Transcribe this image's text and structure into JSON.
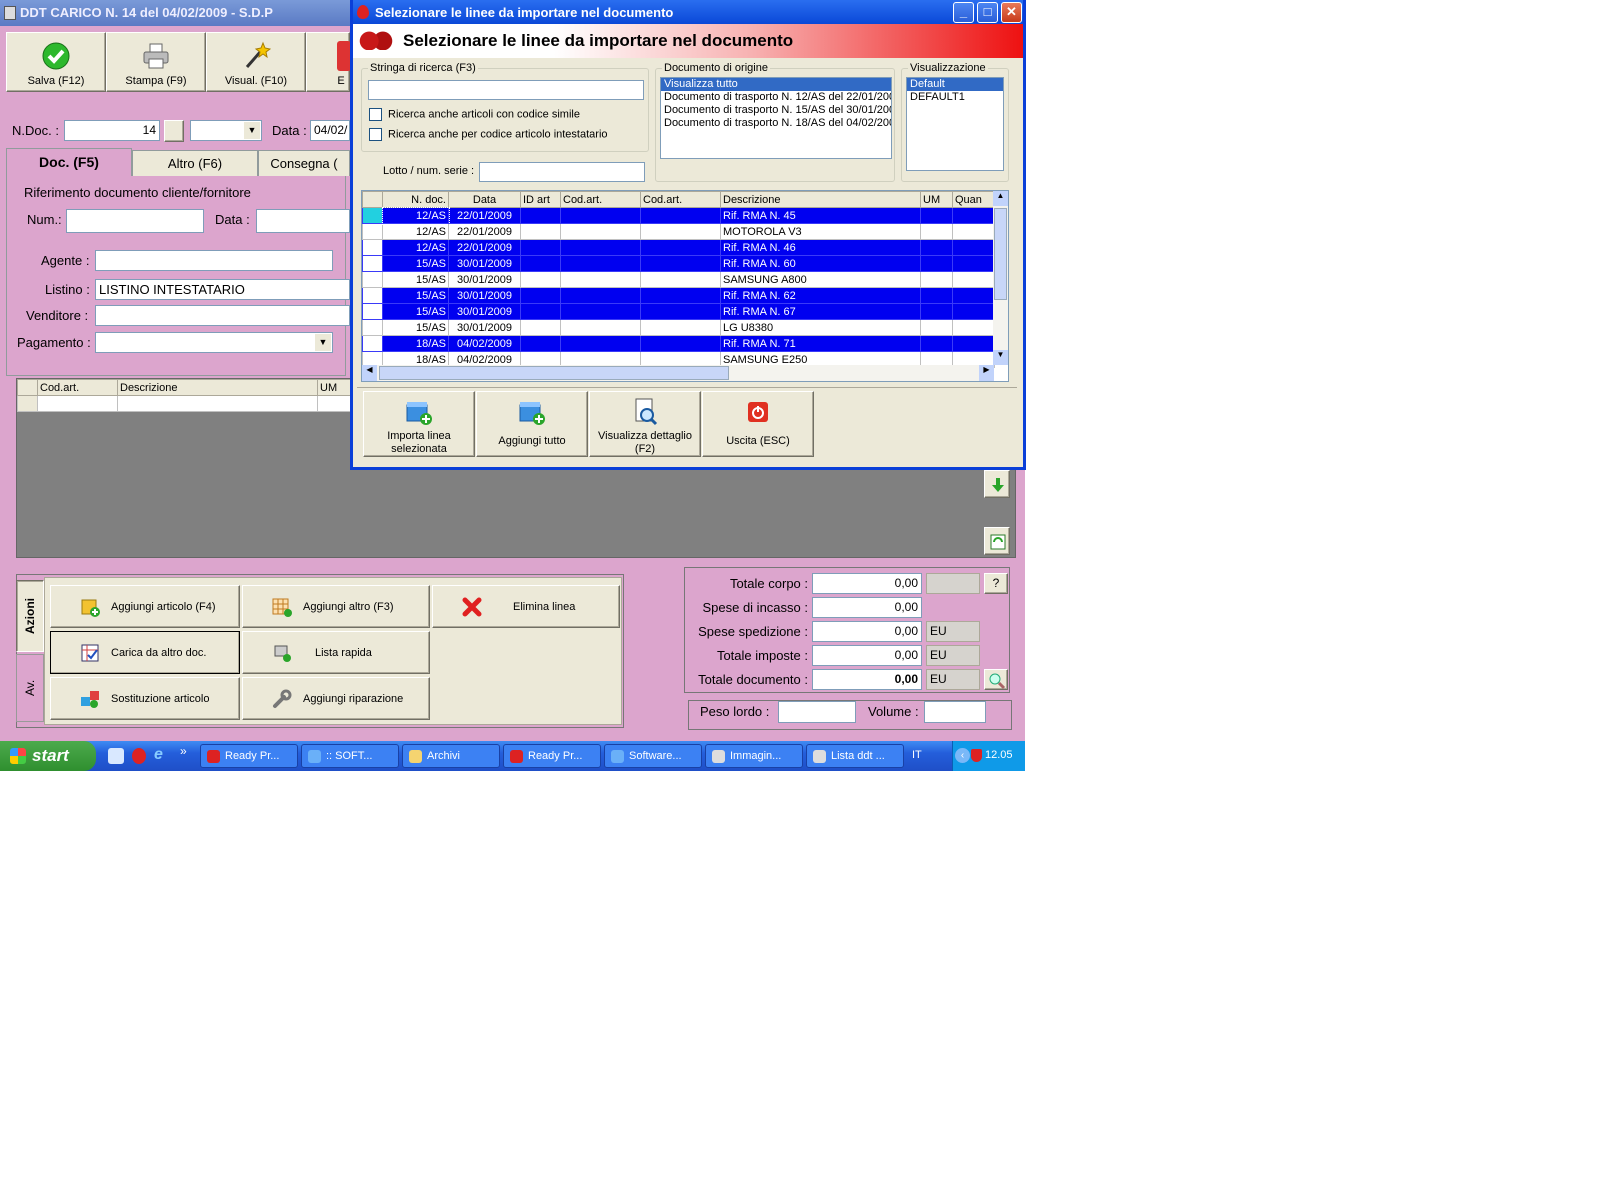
{
  "main_window": {
    "title": "DDT CARICO N. 14  del 04/02/2009 - S.D.P",
    "toolbar": [
      {
        "label": "Salva (F12)",
        "icon": "checkmark-icon"
      },
      {
        "label": "Stampa (F9)",
        "icon": "printer-icon"
      },
      {
        "label": "Visual. (F10)",
        "icon": "magic-wand-icon"
      },
      {
        "label": "E",
        "icon": "partial-icon"
      }
    ],
    "ndoc_label": "N.Doc. :",
    "ndoc_value": "14",
    "data_label": "Data :",
    "data_value": "04/02/",
    "tabs": [
      "Doc. (F5)",
      "Altro (F6)",
      "Consegna ("
    ],
    "rif_legend": "Riferimento documento cliente/fornitore",
    "num_label": "Num.:",
    "rif_data_label": "Data :",
    "agente_label": "Agente :",
    "listino_label": "Listino :",
    "listino_value": "LISTINO INTESTATARIO",
    "venditore_label": "Venditore :",
    "pagamento_label": "Pagamento :",
    "lines_headers": [
      "Cod.art.",
      "Descrizione",
      "UM"
    ],
    "side_tabs": [
      "Azioni",
      "Av."
    ],
    "actions": [
      {
        "label": "Aggiungi articolo (F4)",
        "icon": "add-article-icon"
      },
      {
        "label": "Aggiungi altro (F3)",
        "icon": "add-grid-icon"
      },
      {
        "label": "Elimina linea",
        "icon": "delete-x-icon"
      },
      {
        "label": "Carica da altro doc.",
        "icon": "load-doc-icon"
      },
      {
        "label": "Lista rapida",
        "icon": "quick-list-icon"
      },
      {
        "label": "Sostituzione articolo",
        "icon": "replace-icon"
      },
      {
        "label": "Aggiungi riparazione",
        "icon": "wrench-icon"
      }
    ],
    "totals": [
      {
        "label": "Totale corpo :",
        "value": "0,00",
        "unit": ""
      },
      {
        "label": "Spese di incasso :",
        "value": "0,00",
        "unit": ""
      },
      {
        "label": "Spese spedizione :",
        "value": "0,00",
        "unit": "EU"
      },
      {
        "label": "Totale imposte :",
        "value": "0,00",
        "unit": "EU"
      },
      {
        "label": "Totale documento :",
        "value": "0,00",
        "unit": "EU"
      }
    ],
    "help_button": "?",
    "peso_label": "Peso lordo :",
    "volume_label": "Volume :"
  },
  "dialog": {
    "title": "Selezionare le linee da importare nel documento",
    "header": "Selezionare le linee da importare nel documento",
    "search_legend": "Stringa di ricerca (F3)",
    "search_value": "",
    "check1": "Ricerca anche articoli con codice simile",
    "check2": "Ricerca anche per codice articolo intestatario",
    "lotto_label": "Lotto / num. serie :",
    "origin_legend": "Documento di origine",
    "origin_items": [
      "Visualizza tutto",
      "Documento di trasporto N. 12/AS del 22/01/200",
      "Documento di trasporto N. 15/AS del 30/01/200",
      "Documento di trasporto N. 18/AS del 04/02/200"
    ],
    "view_legend": "Visualizzazione",
    "view_items": [
      "Default",
      "DEFAULT1"
    ],
    "grid_headers": [
      "N. doc.",
      "Data",
      "ID art",
      "Cod.art.",
      "Cod.art.",
      "Descrizione",
      "UM",
      "Quan"
    ],
    "rows": [
      {
        "ndoc": "12/AS",
        "data": "22/01/2009",
        "desc": "Rif. RMA N. 45",
        "hl": true
      },
      {
        "ndoc": "12/AS",
        "data": "22/01/2009",
        "desc": "MOTOROLA V3",
        "hl": false
      },
      {
        "ndoc": "12/AS",
        "data": "22/01/2009",
        "desc": "Rif. RMA N. 46",
        "hl": true
      },
      {
        "ndoc": "15/AS",
        "data": "30/01/2009",
        "desc": "Rif. RMA N. 60",
        "hl": true
      },
      {
        "ndoc": "15/AS",
        "data": "30/01/2009",
        "desc": "SAMSUNG A800",
        "hl": false
      },
      {
        "ndoc": "15/AS",
        "data": "30/01/2009",
        "desc": "Rif. RMA N. 62",
        "hl": true
      },
      {
        "ndoc": "15/AS",
        "data": "30/01/2009",
        "desc": "Rif. RMA N. 67",
        "hl": true
      },
      {
        "ndoc": "15/AS",
        "data": "30/01/2009",
        "desc": "LG U8380",
        "hl": false
      },
      {
        "ndoc": "18/AS",
        "data": "04/02/2009",
        "desc": "Rif. RMA N. 71",
        "hl": true
      },
      {
        "ndoc": "18/AS",
        "data": "04/02/2009",
        "desc": "SAMSUNG E250",
        "hl": false
      }
    ],
    "buttons": [
      {
        "label": "Importa linea selezionata",
        "icon": "import-line-icon"
      },
      {
        "label": "Aggiungi tutto",
        "icon": "add-all-icon"
      },
      {
        "label": "Visualizza dettaglio (F2)",
        "icon": "magnifier-doc-icon"
      },
      {
        "label": "Uscita (ESC)",
        "icon": "power-icon"
      }
    ]
  },
  "taskbar": {
    "start_label": "start",
    "tasks": [
      "Ready Pr...",
      ":: SOFT...",
      "Archivi",
      "Ready Pr...",
      "Software...",
      "Immagin...",
      "Lista ddt ..."
    ],
    "lang": "IT",
    "clock": "12.05"
  },
  "colors": {
    "window_bg": "#dca5cd",
    "dialog_titlebar": "#0a48d8",
    "highlight_row": "#0000f0",
    "taskbar": "#245edb"
  }
}
